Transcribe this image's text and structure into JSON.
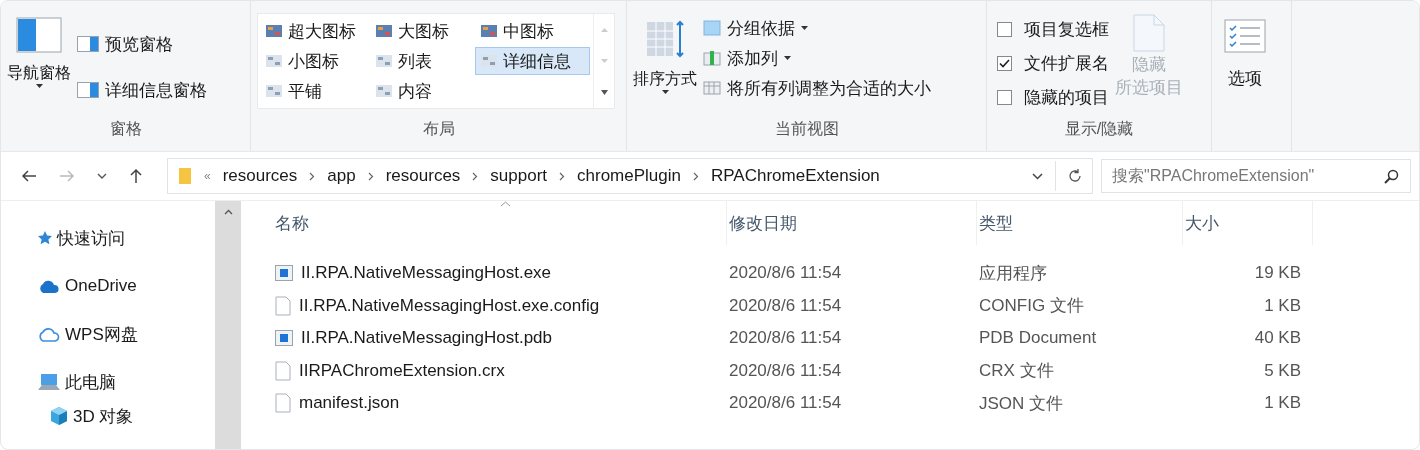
{
  "ribbon": {
    "panes": {
      "nav_button": "导航窗格",
      "items": [
        "预览窗格",
        "详细信息窗格"
      ],
      "label": "窗格"
    },
    "layout": {
      "options": [
        {
          "label": "超大图标",
          "selected": false
        },
        {
          "label": "大图标",
          "selected": false
        },
        {
          "label": "中图标",
          "selected": false
        },
        {
          "label": "小图标",
          "selected": false
        },
        {
          "label": "列表",
          "selected": false
        },
        {
          "label": "详细信息",
          "selected": true
        },
        {
          "label": "平铺",
          "selected": false
        },
        {
          "label": "内容",
          "selected": false
        }
      ],
      "label": "布局"
    },
    "current_view": {
      "sort_button": "排序方式",
      "items": [
        {
          "label": "分组依据",
          "dropdown": true
        },
        {
          "label": "添加列",
          "dropdown": true
        },
        {
          "label": "将所有列调整为合适的大小",
          "dropdown": false
        }
      ],
      "label": "当前视图"
    },
    "show_hide": {
      "checkboxes": [
        {
          "label": "项目复选框",
          "checked": false
        },
        {
          "label": "文件扩展名",
          "checked": true
        },
        {
          "label": "隐藏的项目",
          "checked": false
        }
      ],
      "hide_button": {
        "lines": [
          "隐藏",
          "所选项目"
        ],
        "disabled": true
      },
      "label": "显示/隐藏"
    },
    "options_button": "选项"
  },
  "address_bar": {
    "overflow": "«",
    "path": [
      "resources",
      "app",
      "resources",
      "support",
      "chromePlugin",
      "RPAChromeExtension"
    ]
  },
  "search": {
    "placeholder": "搜索\"RPAChromeExtension\""
  },
  "sidebar": {
    "items": [
      {
        "label": "快速访问",
        "kind": "star"
      },
      {
        "label": "OneDrive",
        "kind": "cloud"
      },
      {
        "label": "WPS网盘",
        "kind": "cloud_outline"
      },
      {
        "label": "此电脑",
        "kind": "computer",
        "children": [
          {
            "label": "3D 对象",
            "kind": "cube"
          }
        ]
      }
    ]
  },
  "table": {
    "columns": [
      {
        "label": "名称",
        "sorted": true
      },
      {
        "label": "修改日期",
        "sorted": false
      },
      {
        "label": "类型",
        "sorted": false
      },
      {
        "label": "大小",
        "sorted": false
      }
    ],
    "rows": [
      {
        "name": "II.RPA.NativeMessagingHost.exe",
        "kind": "app",
        "date": "2020/8/6 11:54",
        "type": "应用程序",
        "size": "19 KB"
      },
      {
        "name": "II.RPA.NativeMessagingHost.exe.config",
        "kind": "document",
        "date": "2020/8/6 11:54",
        "type": "CONFIG 文件",
        "size": "1 KB"
      },
      {
        "name": "II.RPA.NativeMessagingHost.pdb",
        "kind": "app",
        "date": "2020/8/6 11:54",
        "type": "PDB Document",
        "size": "40 KB"
      },
      {
        "name": "IIRPAChromeExtension.crx",
        "kind": "document",
        "date": "2020/8/6 11:54",
        "type": "CRX 文件",
        "size": "5 KB"
      },
      {
        "name": "manifest.json",
        "kind": "document",
        "date": "2020/8/6 11:54",
        "type": "JSON 文件",
        "size": "1 KB"
      }
    ]
  }
}
